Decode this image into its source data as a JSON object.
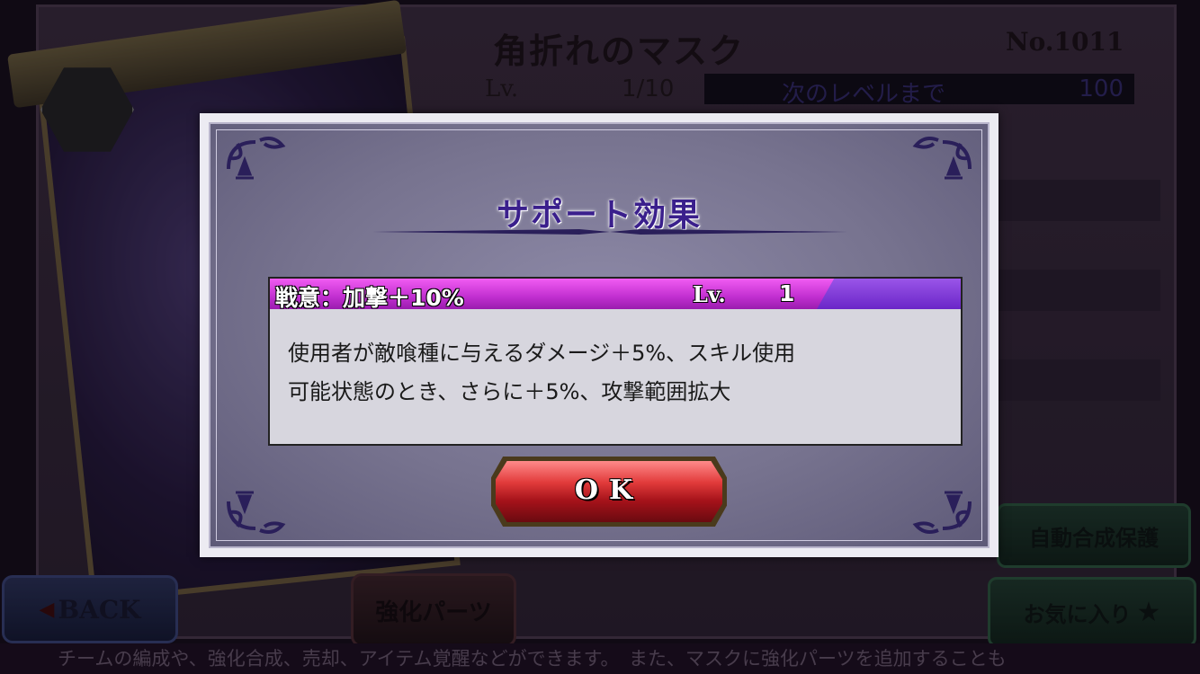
{
  "background": {
    "item_title": "角折れのマスク",
    "item_number": "No.1011",
    "level_label": "Lv.",
    "level_value": "1/10",
    "next_level_label": "次のレベルまで",
    "next_level_value": "100",
    "back_button": "BACK",
    "parts_button": "強化パーツ",
    "auto_protect_button": "自動合成保護",
    "favorite_button": "お気に入り",
    "ticker_text": "チームの編成や、強化合成、売却、アイテム覚醒などができます。　また、マスクに強化パーツを追加することも"
  },
  "modal": {
    "title": "サポート効果",
    "skill": {
      "name": "戦意：加撃＋10%",
      "level_label": "Lv.",
      "level_value": "1",
      "description_line1": "使用者が敵喰種に与えるダメージ＋5%、スキル使用",
      "description_line2": "可能状態のとき、さらに＋5%、攻撃範囲拡大"
    },
    "ok_button": "OK"
  },
  "colors": {
    "title_color": "#3a1f8c",
    "skill_header": "#d03ce0",
    "ok_button": "#d42a2a"
  }
}
